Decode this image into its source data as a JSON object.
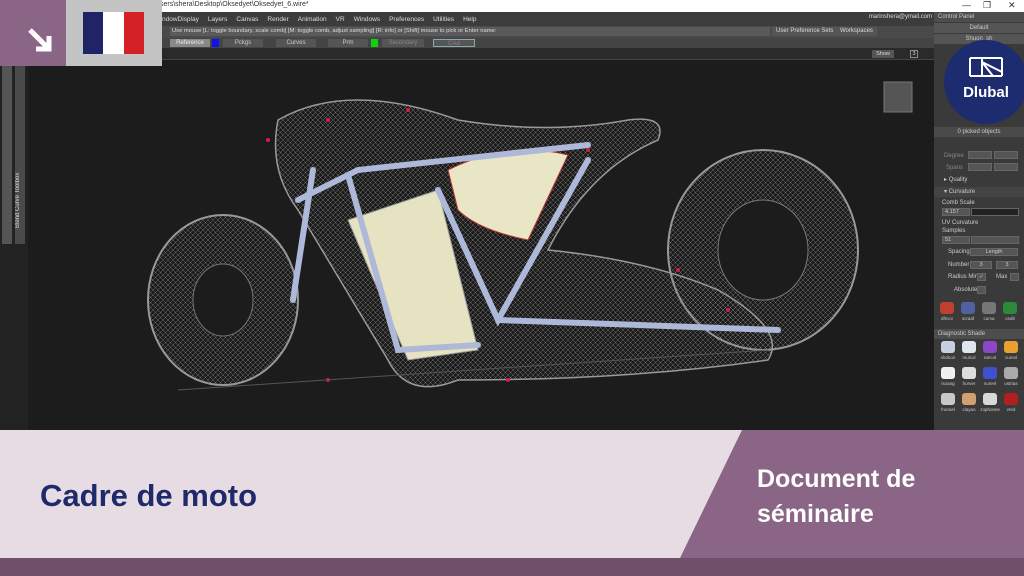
{
  "window": {
    "path": "sers\\shera\\Desktop\\Oksedyet\\Oksedyet_6.wire*",
    "minimize": "—",
    "restore": "❐",
    "close": "✕"
  },
  "menu": [
    "ndowDisplay",
    "Layers",
    "Canvas",
    "Render",
    "Animation",
    "VR",
    "Windows",
    "Preferences",
    "Utilities",
    "Help"
  ],
  "user_email": "marinshera@ymail.com",
  "prompt": {
    "message": "Use mouse [L: toggle boundary, scale comb] [M: toggle comb, adjust sampling] [R: info] or [Shift] mouse to pick or Enter name:",
    "user_pref_sets": "User Preference Sets",
    "workspaces": "Workspaces"
  },
  "toolbar": {
    "reference": "Reference",
    "picks": "Pckgs",
    "curves": "Curves",
    "prm": "Prm",
    "secondary": "Secondary",
    "cad": "CAd"
  },
  "viewbar": {
    "show": "Show",
    "num": "3"
  },
  "left_toolbox": "Blend Curve Toolbox",
  "control_panel": {
    "title": "Control Panel",
    "preset": "Default",
    "shelf": "Shuon_sh",
    "picked": "0 picked objects",
    "degree": "Degree",
    "spans": "Spans",
    "quality": "Quality",
    "curvature": "Curvature",
    "comb_scale_label": "Comb Scale",
    "comb_scale": "4.157",
    "uv_curvature": "UV Curvature",
    "samples_label": "Samples",
    "samples": "51",
    "spacing_label": "Spacing",
    "spacing": "Length",
    "number_label": "Number",
    "number_a": "3",
    "number_b": "3",
    "radius_min": "Radius Min",
    "max": "Max",
    "absolute": "Absolute",
    "tools": [
      "dfmcv",
      "scraaf",
      "curva",
      "cedit"
    ],
    "diag_title": "Diagnostic Shade",
    "diag": [
      {
        "label": "shdnon",
        "color": "#c8d0e0"
      },
      {
        "label": "mulcol",
        "color": "#e0e6f0"
      },
      {
        "label": "rancol",
        "color": "#8a48c8"
      },
      {
        "label": "curevl",
        "color": "#e8a030"
      },
      {
        "label": "isoang",
        "color": "#f0f0f0"
      },
      {
        "label": "horver",
        "color": "#dddddd"
      },
      {
        "label": "surevl",
        "color": "#4050d0"
      },
      {
        "label": "ustrias",
        "color": "#aaaaaa"
      },
      {
        "label": "frunnel",
        "color": "#c8c8c8"
      },
      {
        "label": "clayao",
        "color": "#d0a070"
      },
      {
        "label": "zophones",
        "color": "#d8d8d8"
      },
      {
        "label": "vred",
        "color": "#b02020"
      }
    ]
  },
  "flag_colors": [
    "#1f2466",
    "#ffffff",
    "#d42027"
  ],
  "brand": {
    "name": "Dlubal",
    "color": "#1d2b6f"
  },
  "banner": {
    "title": "Cadre de moto",
    "doc_type": "Document de séminaire"
  }
}
